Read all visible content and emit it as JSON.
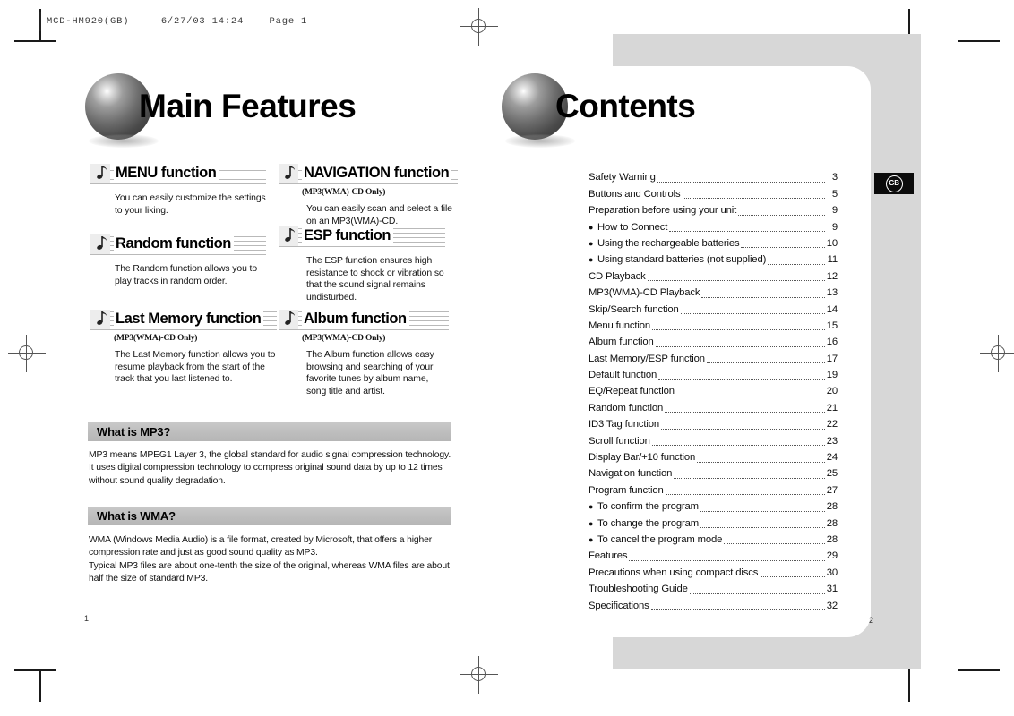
{
  "print_header": "MCD-HM920(GB)     6/27/03 14:24    Page 1",
  "badge": {
    "label": "GB"
  },
  "left_page": {
    "title": "Main Features",
    "page_number": "1",
    "features": [
      {
        "title": "MENU function",
        "subtitle": "",
        "body": "You can easily customize the settings to your liking."
      },
      {
        "title": "Random function",
        "subtitle": "",
        "body": "The Random function allows you to play tracks in random order."
      },
      {
        "title": "Last Memory function",
        "subtitle": "(MP3(WMA)-CD Only)",
        "body": "The Last Memory function allows you to resume playback from the start of the track that you last listened to."
      },
      {
        "title": "NAVIGATION function",
        "subtitle": "(MP3(WMA)-CD Only)",
        "body": "You can easily scan and select a file on an MP3(WMA)-CD."
      },
      {
        "title": "ESP function",
        "subtitle": "",
        "body": "The ESP function ensures high resistance to shock or vibration so that the sound signal remains undisturbed."
      },
      {
        "title": "Album function",
        "subtitle": "(MP3(WMA)-CD Only)",
        "body": "The Album function allows easy browsing and searching of your favorite tunes by album name, song title and artist."
      }
    ],
    "sections": [
      {
        "heading": "What is MP3?",
        "body": "MP3 means MPEG1 Layer 3, the global standard for audio signal compression technology. It uses digital compression technology to compress original sound data by up to 12 times without sound quality degradation."
      },
      {
        "heading": "What is WMA?",
        "body": "WMA (Windows Media Audio) is a file format, created by Microsoft, that offers a higher compression rate and just as good sound quality as MP3.\nTypical MP3 files are about one-tenth the size of the original, whereas WMA files are about half the size of standard MP3."
      }
    ]
  },
  "right_page": {
    "title": "Contents",
    "page_number": "2",
    "toc": [
      {
        "bullet": "",
        "label": "Safety Warning",
        "page": "3"
      },
      {
        "bullet": "",
        "label": "Buttons and Controls",
        "page": "5"
      },
      {
        "bullet": "",
        "label": "Preparation before using your unit",
        "page": "9"
      },
      {
        "bullet": "●",
        "label": "How to Connect",
        "page": "9"
      },
      {
        "bullet": "●",
        "label": "Using the rechargeable batteries",
        "page": "10"
      },
      {
        "bullet": "●",
        "label": "Using standard batteries (not supplied)",
        "page": "11"
      },
      {
        "bullet": "",
        "label": "CD Playback",
        "page": "12"
      },
      {
        "bullet": "",
        "label": "MP3(WMA)-CD Playback",
        "page": "13"
      },
      {
        "bullet": "",
        "label": "Skip/Search function",
        "page": "14"
      },
      {
        "bullet": "",
        "label": "Menu function",
        "page": "15"
      },
      {
        "bullet": "",
        "label": "Album function",
        "page": "16"
      },
      {
        "bullet": "",
        "label": "Last Memory/ESP function",
        "page": "17"
      },
      {
        "bullet": "",
        "label": "Default function",
        "page": "19"
      },
      {
        "bullet": "",
        "label": "EQ/Repeat function",
        "page": "20"
      },
      {
        "bullet": "",
        "label": "Random function",
        "page": "21"
      },
      {
        "bullet": "",
        "label": "ID3 Tag function",
        "page": "22"
      },
      {
        "bullet": "",
        "label": "Scroll function",
        "page": "23"
      },
      {
        "bullet": "",
        "label": "Display Bar/+10 function",
        "page": "24"
      },
      {
        "bullet": "",
        "label": "Navigation function",
        "page": "25"
      },
      {
        "bullet": "",
        "label": "Program function",
        "page": "27"
      },
      {
        "bullet": "●",
        "label": "To confirm the program",
        "page": "28"
      },
      {
        "bullet": "●",
        "label": "To change the program",
        "page": "28"
      },
      {
        "bullet": "●",
        "label": "To cancel the program mode",
        "page": "28"
      },
      {
        "bullet": "",
        "label": "Features",
        "page": "29"
      },
      {
        "bullet": "",
        "label": "Precautions when using compact discs",
        "page": "30"
      },
      {
        "bullet": "",
        "label": "Troubleshooting Guide",
        "page": "31"
      },
      {
        "bullet": "",
        "label": "Specifications",
        "page": "32"
      }
    ]
  }
}
